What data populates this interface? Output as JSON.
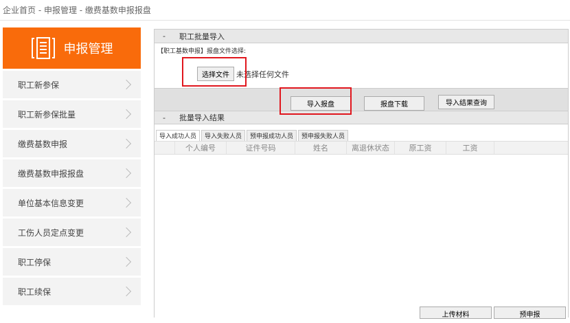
{
  "breadcrumb": "企业首页 - 申报管理 - 缴费基数申报报盘",
  "sidebar": {
    "title": "申报管理",
    "items": [
      "职工新参保",
      "职工新参保批量",
      "缴费基数申报",
      "缴费基数申报报盘",
      "单位基本信息变更",
      "工伤人员定点变更",
      "职工停保",
      "职工续保"
    ]
  },
  "import": {
    "title": "职工批量导入",
    "label": "【职工基数申报】报盘文件选择:",
    "choose": "选择文件",
    "no_file": "未选择任何文件",
    "buttons": [
      "导入报盘",
      "报盘下载",
      "导入结果查询"
    ]
  },
  "result": {
    "title": "批量导入结果",
    "tabs": [
      "导入成功人员",
      "导入失败人员",
      "预申报成功人员",
      "预申报失败人员"
    ],
    "columns": [
      "个人编号",
      "证件号码",
      "姓名",
      "离退休状态",
      "原工资",
      "工资"
    ]
  },
  "footer": {
    "upload": "上传材料",
    "predeclare": "预申报"
  },
  "colors": {
    "accent": "#f96b0b",
    "highlight": "#e0161d"
  }
}
